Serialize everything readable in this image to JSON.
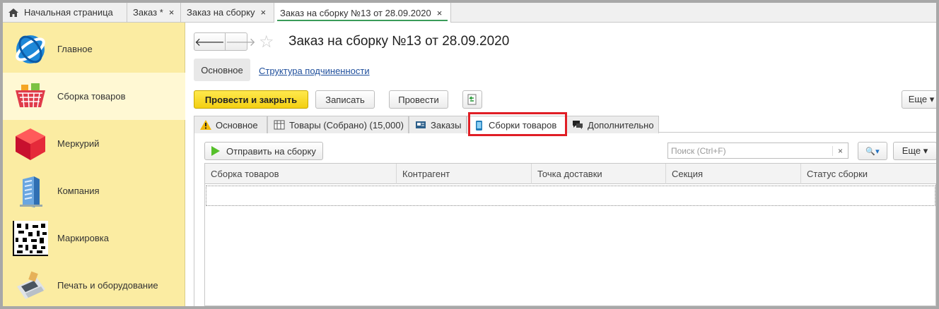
{
  "window_tabs": [
    {
      "label": "Начальная страница",
      "closable": false
    },
    {
      "label": "Заказ *",
      "closable": true
    },
    {
      "label": "Заказ на сборку",
      "closable": true
    },
    {
      "label": "Заказ на сборку №13 от 28.09.2020",
      "closable": true,
      "active": true
    }
  ],
  "close_glyph": "×",
  "sidebar": {
    "items": [
      {
        "label": "Главное",
        "icon": "main-globe-icon"
      },
      {
        "label": "Сборка товаров",
        "icon": "basket-icon",
        "active": true
      },
      {
        "label": "Меркурий",
        "icon": "red-cube-icon"
      },
      {
        "label": "Компания",
        "icon": "building-icon"
      },
      {
        "label": "Маркировка",
        "icon": "datamatrix-icon"
      },
      {
        "label": "Печать и оборудование",
        "icon": "payment-terminal-icon"
      }
    ]
  },
  "header": {
    "title": "Заказ на сборку №13 от 28.09.2020",
    "back_glyph": "🡐",
    "forward_glyph": "🡒",
    "star_glyph": "☆"
  },
  "subnav": {
    "main": "Основное",
    "link": "Структура подчиненности"
  },
  "toolbar": {
    "post_close": "Провести и закрыть",
    "save": "Записать",
    "post": "Провести",
    "more": "Еще ▾"
  },
  "form_tabs": [
    {
      "label": "Основное",
      "icon": "warning-icon"
    },
    {
      "label": "Товары (Собрано) (15,000)",
      "icon": "goods-icon"
    },
    {
      "label": "Заказы",
      "icon": "orders-icon"
    },
    {
      "label": "Сборки товаров",
      "icon": "phone-icon",
      "active": true
    },
    {
      "label": "Дополнительно",
      "icon": "chat-icon"
    }
  ],
  "tab_toolbar": {
    "send": "Отправить на сборку",
    "search_placeholder": "Поиск (Ctrl+F)",
    "clear_glyph": "×",
    "search_glyph": "🔍▾",
    "more": "Еще ▾"
  },
  "table": {
    "columns": [
      "Сборка товаров",
      "Контрагент",
      "Точка доставки",
      "Секция",
      "Статус сборки"
    ]
  },
  "colors": {
    "sidebar_bg": "#fbeca2",
    "primary_button": "#f3cf12",
    "highlight": "#e01e25",
    "active_tab_underline": "#3a9b5a",
    "link": "#1f4f9c"
  }
}
